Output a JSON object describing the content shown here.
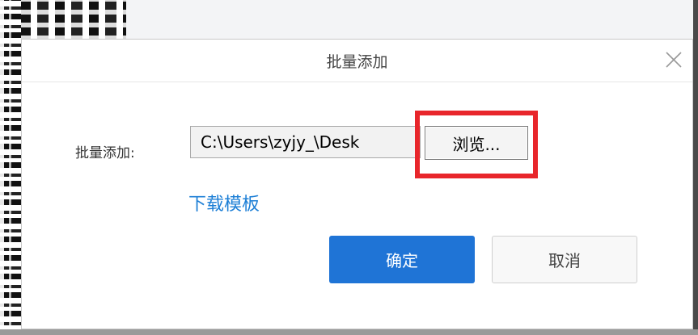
{
  "dialog": {
    "title": "批量添加",
    "close_icon": "close-icon",
    "field_label": "批量添加:",
    "file_path_value": "C:\\Users\\zyjy_\\Desk",
    "browse_label": "浏览...",
    "download_template_label": "下载模板",
    "ok_label": "确定",
    "cancel_label": "取消"
  },
  "colors": {
    "primary": "#1f74d6",
    "link": "#1d7fd6",
    "highlight_border": "#e8262b"
  }
}
